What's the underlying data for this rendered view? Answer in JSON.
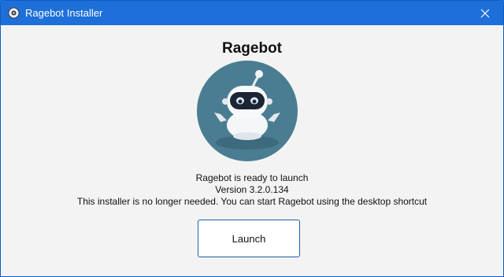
{
  "window": {
    "title": "Ragebot Installer",
    "icon": "app-icon",
    "close_icon": "close-icon"
  },
  "main": {
    "heading": "Ragebot",
    "logo_icon": "robot-logo-icon",
    "status_line": "Ragebot is ready to launch",
    "version_line": "Version 3.2.0.134",
    "info_line": "This installer is no longer needed. You can start Ragebot using the desktop shortcut",
    "launch_label": "Launch"
  },
  "colors": {
    "titlebar": "#1e6fd9",
    "background": "#f3f3f3",
    "logo_circle": "#4a7d92",
    "button_border": "#1b5fb0"
  }
}
